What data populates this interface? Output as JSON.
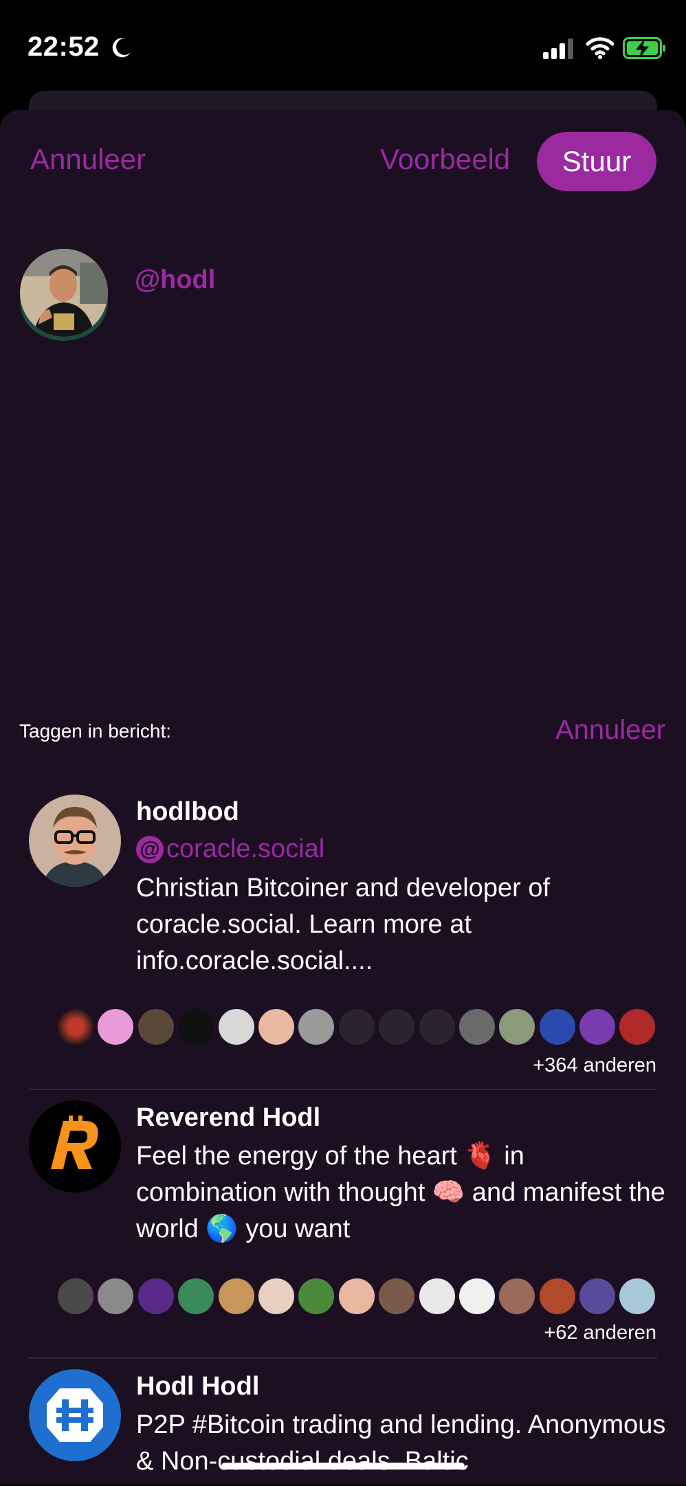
{
  "status_bar": {
    "time": "22:52",
    "icons": [
      "moon-icon",
      "signal-icon",
      "wifi-icon",
      "battery-charging-icon"
    ]
  },
  "header": {
    "cancel_label": "Annuleer",
    "preview_label": "Voorbeeld",
    "send_label": "Stuur"
  },
  "composer": {
    "mention": "@hodl"
  },
  "tag_panel": {
    "label": "Taggen in bericht:",
    "cancel_label": "Annuleer"
  },
  "people": [
    {
      "name": "hodlbod",
      "handle": "coracle.social",
      "bio": "Christian Bitcoiner and developer of coracle.social. Learn more at info.coracle.social....",
      "others": "+364 anderen"
    },
    {
      "name": "Reverend Hodl",
      "bio": "Feel the energy of the heart 🫀 in combination with thought 🧠 and manifest the world 🌎 you want",
      "others": "+62 anderen"
    },
    {
      "name": "Hodl Hodl",
      "bio": "P2P #Bitcoin trading and lending. Anonymous & Non-custodial deals. Baltic"
    }
  ],
  "colors": {
    "accent": "#9b2aa1",
    "sheet_background": "#1c0f22"
  }
}
